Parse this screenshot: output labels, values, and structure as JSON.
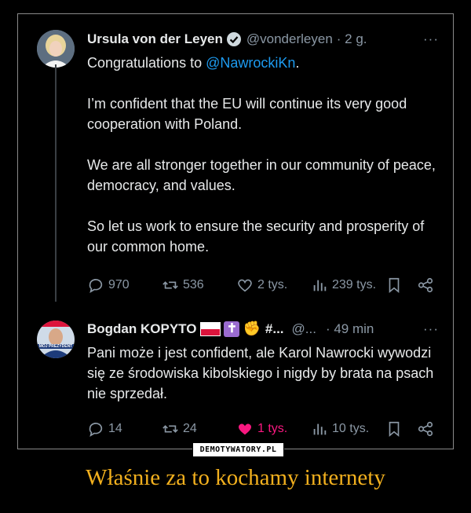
{
  "tweets": [
    {
      "author": "Ursula von der Leyen",
      "handle": "@vonderleyen",
      "time": "· 2 g.",
      "more": "···",
      "paragraphs": [
        {
          "prefix": "Congratulations to ",
          "mention": "@NawrockiKn",
          "suffix": "."
        },
        {
          "text": "I’m confident that the EU will continue its very good cooperation with Poland."
        },
        {
          "text": "We are all stronger together in our community of peace, democracy, and values."
        },
        {
          "text": "So let us work to ensure the security and prosperity of our common home."
        }
      ],
      "stats": {
        "replies": "970",
        "reposts": "536",
        "likes": "2 tys.",
        "views": "239 tys."
      }
    },
    {
      "author": "Bogdan KOPYTO",
      "name_suffix": "#...",
      "handle": "@...",
      "time": "· 49 min",
      "more": "···",
      "avatar_text": "MÓJ PREZYDENT",
      "paragraphs": [
        {
          "text": "Pani może i jest confident, ale Karol Nawrocki wywodzi się ze środowiska kibolskiego i nigdy by brata na psach nie sprzedał."
        }
      ],
      "stats": {
        "replies": "14",
        "reposts": "24",
        "likes": "1 tys.",
        "views": "10 tys."
      }
    }
  ],
  "watermark": "DEMOTYWATORY.PL",
  "caption": "Właśnie za to kochamy internety",
  "colors": {
    "accent_blue": "#1d9bf0",
    "like_pink": "#f91880",
    "caption_gold": "#f2b01e",
    "muted": "#8b98a5"
  }
}
